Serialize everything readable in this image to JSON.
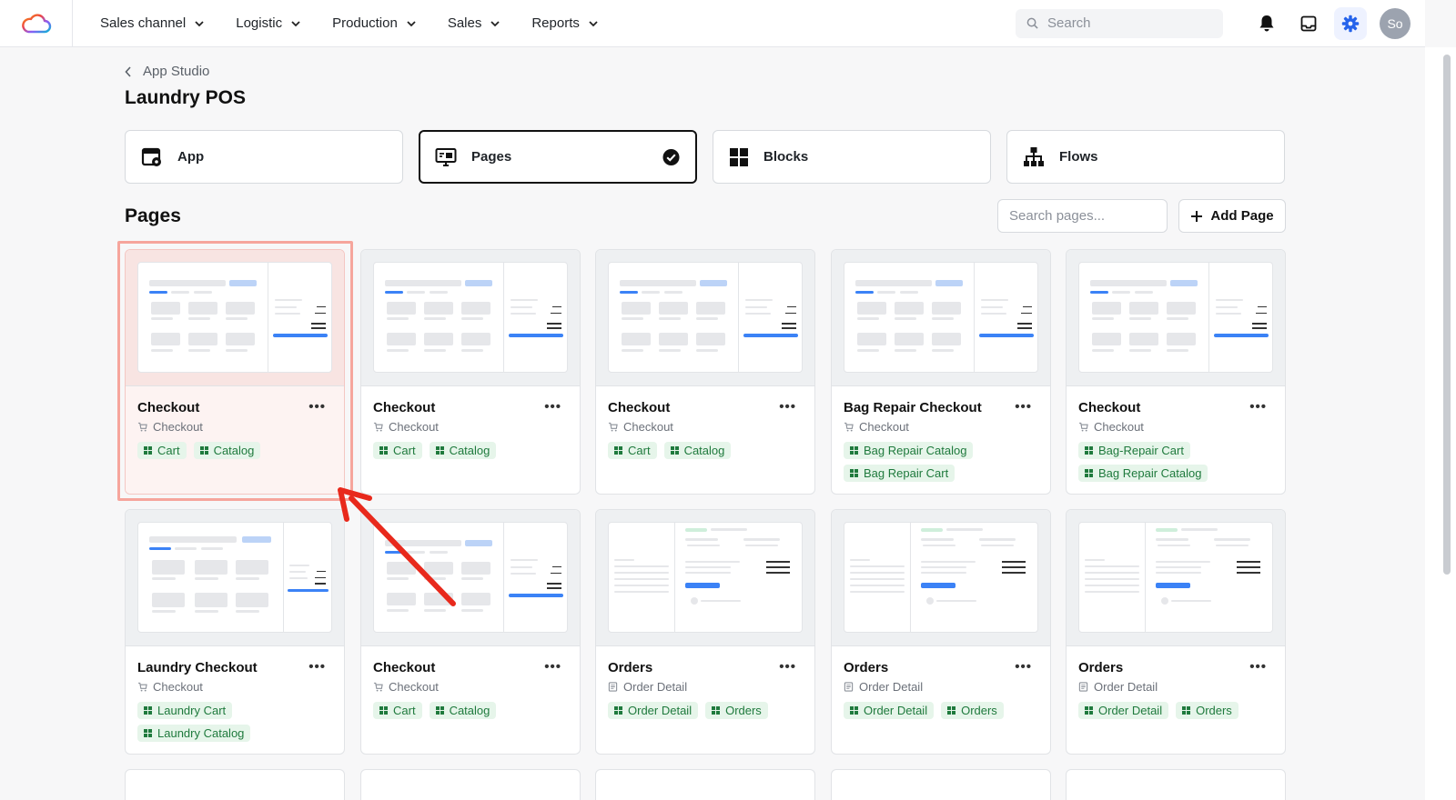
{
  "nav": {
    "items": [
      {
        "label": "Sales channel"
      },
      {
        "label": "Logistic"
      },
      {
        "label": "Production"
      },
      {
        "label": "Sales"
      },
      {
        "label": "Reports"
      }
    ],
    "search_placeholder": "Search",
    "avatar_initials": "So",
    "accent_color": "#2563eb"
  },
  "header": {
    "breadcrumb": "App Studio",
    "title": "Laundry POS"
  },
  "tabs": [
    {
      "label": "App",
      "icon": "app-settings-icon"
    },
    {
      "label": "Pages",
      "icon": "monitor-icon",
      "selected": true
    },
    {
      "label": "Blocks",
      "icon": "blocks-grid-icon"
    },
    {
      "label": "Flows",
      "icon": "flow-tree-icon"
    }
  ],
  "pages_section": {
    "title": "Pages",
    "search_placeholder": "Search pages...",
    "add_label": "Add Page"
  },
  "cards": [
    {
      "title": "Checkout",
      "type": "Checkout",
      "tags": [
        "Cart",
        "Catalog"
      ]
    },
    {
      "title": "Checkout",
      "type": "Checkout",
      "tags": [
        "Cart",
        "Catalog"
      ]
    },
    {
      "title": "Checkout",
      "type": "Checkout",
      "tags": [
        "Cart",
        "Catalog"
      ]
    },
    {
      "title": "Bag Repair Checkout",
      "type": "Checkout",
      "tags": [
        "Bag Repair Catalog",
        "Bag Repair Cart"
      ]
    },
    {
      "title": "Checkout",
      "type": "Checkout",
      "tags": [
        "Bag-Repair Cart",
        "Bag Repair Catalog"
      ]
    },
    {
      "title": "Laundry Checkout",
      "type": "Checkout",
      "tags": [
        "Laundry Cart",
        "Laundry Catalog"
      ]
    },
    {
      "title": "Checkout",
      "type": "Checkout",
      "tags": [
        "Cart",
        "Catalog"
      ]
    },
    {
      "title": "Orders",
      "type": "Order Detail",
      "tags": [
        "Order Detail",
        "Orders"
      ]
    },
    {
      "title": "Orders",
      "type": "Order Detail",
      "tags": [
        "Order Detail",
        "Orders"
      ]
    },
    {
      "title": "Orders",
      "type": "Order Detail",
      "tags": [
        "Order Detail",
        "Orders"
      ]
    }
  ],
  "colors": {
    "highlight_box": "#f6a59c",
    "annotation_arrow": "#e8291c",
    "tag_bg": "#e6f5ea",
    "tag_text": "#1f7a3d"
  }
}
